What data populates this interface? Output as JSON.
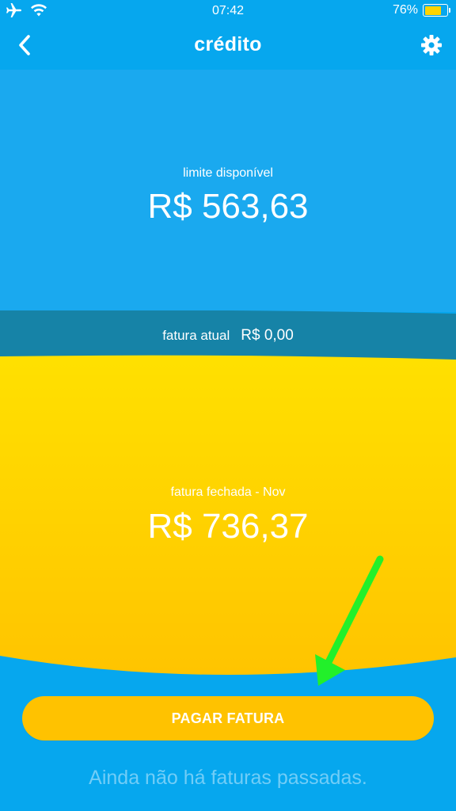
{
  "status_bar": {
    "time": "07:42",
    "battery_percent_label": "76%",
    "battery_level": 0.76,
    "icons": [
      "airplane-icon",
      "wifi-icon",
      "battery-icon"
    ]
  },
  "nav": {
    "title": "crédito",
    "back_icon": "chevron-left-icon",
    "settings_icon": "gear-icon"
  },
  "credit": {
    "label": "limite disponível",
    "amount": "R$ 563,63"
  },
  "current_invoice": {
    "label": "fatura atual",
    "amount": "R$ 0,00"
  },
  "closed_invoice": {
    "label": "fatura fechada - Nov",
    "amount": "R$ 736,37"
  },
  "actions": {
    "pay_label": "PAGAR FATURA"
  },
  "history": {
    "empty_message": "Ainda não há faturas passadas."
  },
  "colors": {
    "background_blue": "#06a7ee",
    "section_blue": "#1aa9ef",
    "band_teal": "#1683a7",
    "yellow_top": "#ffe100",
    "yellow_bottom": "#ffc400",
    "button_yellow": "#ffc200",
    "annotation_green": "#22f02a",
    "muted_text": "#71cdf7"
  }
}
